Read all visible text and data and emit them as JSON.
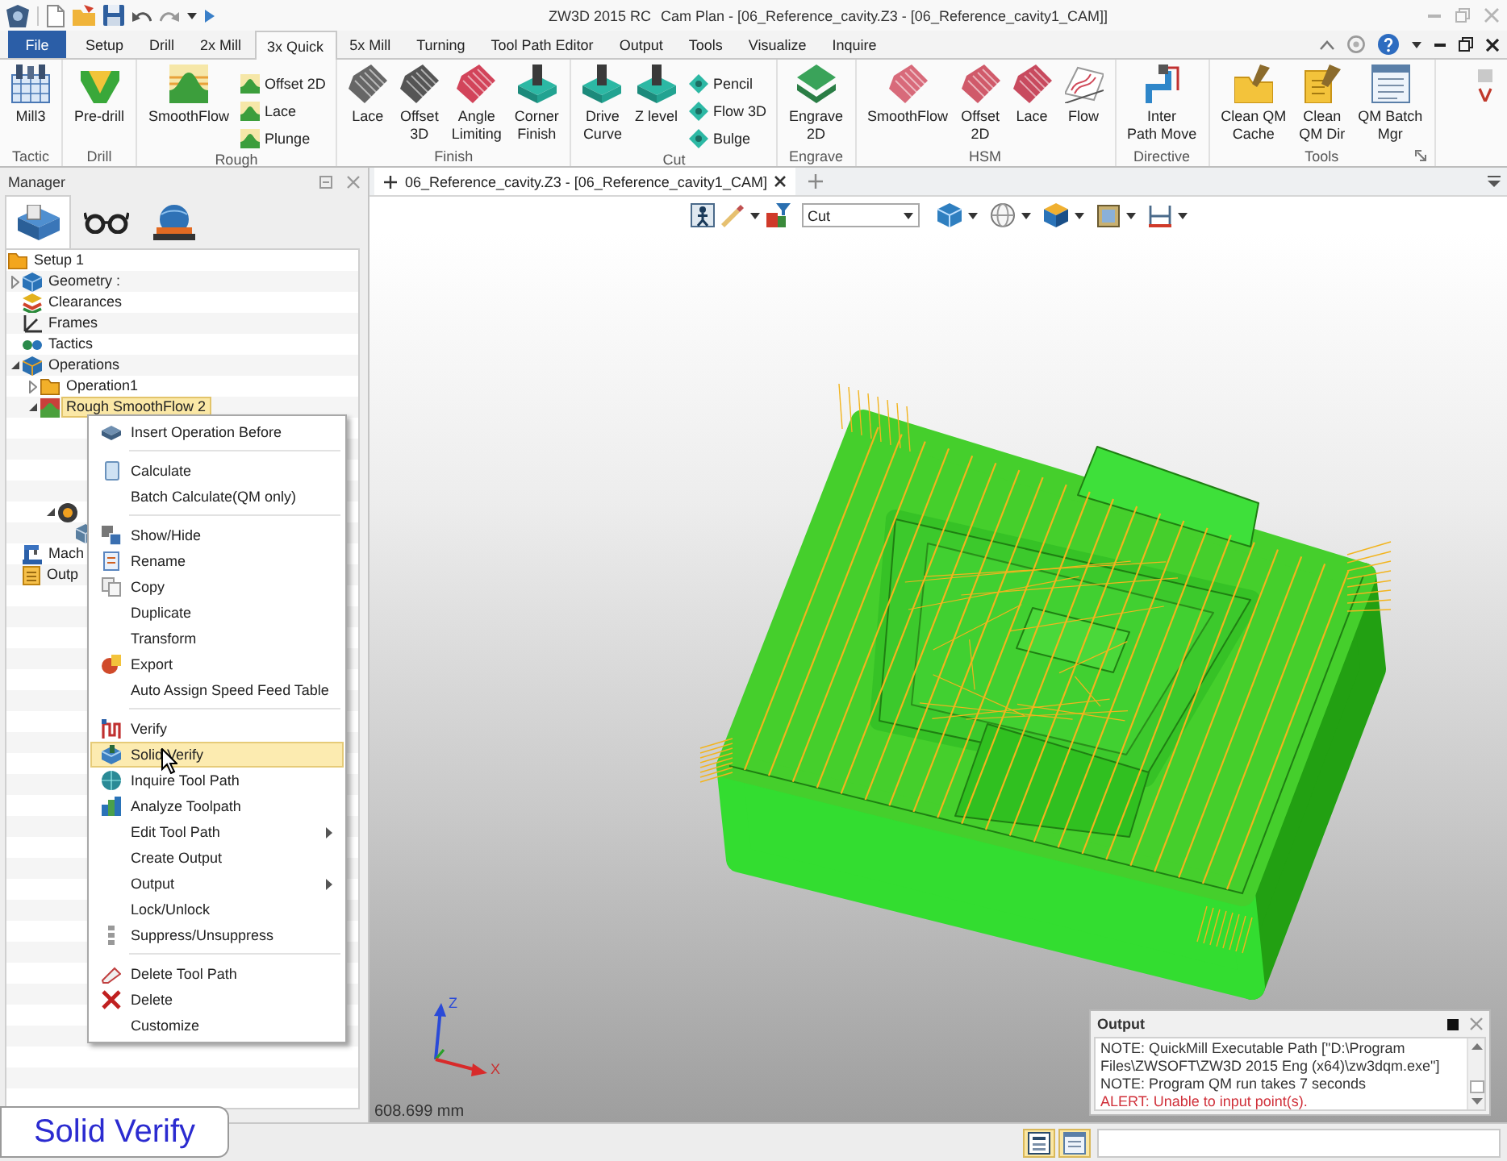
{
  "title_bar": {
    "app_title": "ZW3D 2015 RC",
    "document_title": "Cam Plan - [06_Reference_cavity.Z3 - [06_Reference_cavity1_CAM]]"
  },
  "ribbon_tabs": [
    {
      "label": "File",
      "kind": "file",
      "selected": false
    },
    {
      "label": "Setup",
      "kind": "tab",
      "selected": false
    },
    {
      "label": "Drill",
      "kind": "tab",
      "selected": false
    },
    {
      "label": "2x Mill",
      "kind": "tab",
      "selected": false
    },
    {
      "label": "3x Quick",
      "kind": "tab",
      "selected": true
    },
    {
      "label": "5x Mill",
      "kind": "tab",
      "selected": false
    },
    {
      "label": "Turning",
      "kind": "tab",
      "selected": false
    },
    {
      "label": "Tool Path Editor",
      "kind": "tab",
      "selected": false
    },
    {
      "label": "Output",
      "kind": "tab",
      "selected": false
    },
    {
      "label": "Tools",
      "kind": "tab",
      "selected": false
    },
    {
      "label": "Visualize",
      "kind": "tab",
      "selected": false
    },
    {
      "label": "Inquire",
      "kind": "tab",
      "selected": false
    }
  ],
  "ribbon_groups": [
    {
      "label": "Tactic",
      "tools": [
        {
          "label": "Mill3",
          "kind": "large"
        }
      ]
    },
    {
      "label": "Drill",
      "tools": [
        {
          "label": "Pre-drill",
          "kind": "large"
        }
      ]
    },
    {
      "label": "Rough",
      "tools": [
        {
          "label": "SmoothFlow",
          "kind": "large"
        },
        {
          "label": "Offset 2D",
          "kind": "small"
        },
        {
          "label": "Lace",
          "kind": "small"
        },
        {
          "label": "Plunge",
          "kind": "small"
        }
      ]
    },
    {
      "label": "Finish",
      "tools": [
        {
          "label": "Lace",
          "kind": "large"
        },
        {
          "label": "Offset\n3D",
          "kind": "large"
        },
        {
          "label": "Angle\nLimiting",
          "kind": "large"
        },
        {
          "label": "Corner\nFinish",
          "kind": "large"
        }
      ]
    },
    {
      "label": "Cut",
      "tools": [
        {
          "label": "Drive\nCurve",
          "kind": "large"
        },
        {
          "label": "Z level",
          "kind": "large"
        },
        {
          "label": "Pencil",
          "kind": "small"
        },
        {
          "label": "Flow 3D",
          "kind": "small"
        },
        {
          "label": "Bulge",
          "kind": "small"
        }
      ]
    },
    {
      "label": "Engrave",
      "tools": [
        {
          "label": "Engrave\n2D",
          "kind": "large"
        }
      ]
    },
    {
      "label": "HSM",
      "tools": [
        {
          "label": "SmoothFlow",
          "kind": "large"
        },
        {
          "label": "Offset\n2D",
          "kind": "large"
        },
        {
          "label": "Lace",
          "kind": "large"
        },
        {
          "label": "Flow",
          "kind": "large"
        }
      ]
    },
    {
      "label": "Directive",
      "tools": [
        {
          "label": "Inter\nPath Move",
          "kind": "large"
        }
      ]
    },
    {
      "label": "Tools",
      "dialog_launcher": true,
      "tools": [
        {
          "label": "Clean QM\nCache",
          "kind": "large"
        },
        {
          "label": "Clean\nQM Dir",
          "kind": "large"
        },
        {
          "label": "QM Batch\nMgr",
          "kind": "large"
        }
      ]
    }
  ],
  "manager": {
    "title": "Manager",
    "tabs": [
      {
        "selected": true
      },
      {
        "selected": false
      },
      {
        "selected": false
      }
    ],
    "tree": [
      {
        "label": "Setup 1",
        "kind": "setup",
        "selected": false,
        "children": [
          {
            "label": "Geometry :",
            "kind": "geometry",
            "selected": false,
            "expanded": false
          },
          {
            "label": "Clearances",
            "kind": "clearances",
            "selected": false
          },
          {
            "label": "Frames",
            "kind": "frames",
            "selected": false
          },
          {
            "label": "Tactics",
            "kind": "tactics",
            "selected": false
          },
          {
            "label": "Operations",
            "kind": "operations",
            "selected": false,
            "expanded": true,
            "children": [
              {
                "label": "Operation1",
                "kind": "folder",
                "selected": false,
                "expanded": false
              },
              {
                "label": "Rough SmoothFlow 2",
                "kind": "toolpath",
                "selected": true,
                "expanded": true,
                "children": [
                  {
                    "kind": "tool",
                    "expanded": true,
                    "children": [
                      {
                        "kind": "solid"
                      }
                    ]
                  }
                ]
              }
            ]
          },
          {
            "label": "Mach",
            "kind": "machine",
            "selected": false
          },
          {
            "label": "Outp",
            "kind": "output",
            "selected": false
          }
        ]
      }
    ]
  },
  "document_tabs": [
    {
      "label": "06_Reference_cavity.Z3 - [06_Reference_cavity1_CAM]",
      "selected": true
    }
  ],
  "view_toolbar": {
    "mode_combo": {
      "value": "Cut"
    }
  },
  "viewport": {
    "scale_reading": "608.699 mm",
    "axis_labels": {
      "z": "Z",
      "x": "X"
    }
  },
  "context_menu": {
    "sections": [
      [
        {
          "label": "Insert Operation Before",
          "selected": false,
          "submenu": false
        }
      ],
      [
        {
          "label": "Calculate",
          "selected": false,
          "submenu": false
        },
        {
          "label": "Batch Calculate(QM only)",
          "selected": false,
          "submenu": false
        }
      ],
      [
        {
          "label": "Show/Hide",
          "selected": false,
          "submenu": false
        },
        {
          "label": "Rename",
          "selected": false,
          "submenu": false
        },
        {
          "label": "Copy",
          "selected": false,
          "submenu": false
        },
        {
          "label": "Duplicate",
          "selected": false,
          "submenu": false
        },
        {
          "label": "Transform",
          "selected": false,
          "submenu": false
        },
        {
          "label": "Export",
          "selected": false,
          "submenu": false
        },
        {
          "label": "Auto Assign Speed Feed Table",
          "selected": false,
          "submenu": false
        }
      ],
      [
        {
          "label": "Verify",
          "selected": false,
          "submenu": false
        },
        {
          "label": "Solid Verify",
          "selected": true,
          "submenu": false
        },
        {
          "label": "Inquire Tool Path",
          "selected": false,
          "submenu": false
        },
        {
          "label": "Analyze Toolpath",
          "selected": false,
          "submenu": false
        },
        {
          "label": "Edit Tool Path",
          "selected": false,
          "submenu": true
        },
        {
          "label": "Create Output",
          "selected": false,
          "submenu": false
        },
        {
          "label": "Output",
          "selected": false,
          "submenu": true
        },
        {
          "label": "Lock/Unlock",
          "selected": false,
          "submenu": false
        },
        {
          "label": "Suppress/Unsuppress",
          "selected": false,
          "submenu": false
        }
      ],
      [
        {
          "label": "Delete Tool Path",
          "selected": false,
          "submenu": false
        },
        {
          "label": "Delete",
          "selected": false,
          "submenu": false
        },
        {
          "label": "Customize",
          "selected": false,
          "submenu": false
        }
      ]
    ]
  },
  "output_panel": {
    "title": "Output",
    "lines": [
      {
        "text": "NOTE: QuickMill Executable Path [\"D:\\Program Files\\ZWSOFT\\ZW3D 2015 Eng (x64)\\zw3dqm.exe\"]",
        "kind": "note"
      },
      {
        "text": "NOTE: Program QM run takes 7 seconds",
        "kind": "note"
      },
      {
        "text": "ALERT: Unable to input point(s).",
        "kind": "alert"
      }
    ]
  },
  "status_bar": {
    "toggles": [
      {
        "on": true
      },
      {
        "on": true
      }
    ]
  },
  "caption": {
    "text": "Solid Verify"
  }
}
